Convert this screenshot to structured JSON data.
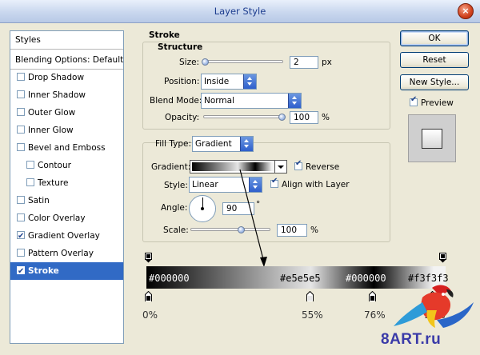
{
  "window": {
    "title": "Layer Style",
    "close_icon": "×"
  },
  "styles_panel": {
    "header": "Styles",
    "blending": "Blending Options: Default",
    "items": [
      {
        "label": "Drop Shadow",
        "checked": false
      },
      {
        "label": "Inner Shadow",
        "checked": false
      },
      {
        "label": "Outer Glow",
        "checked": false
      },
      {
        "label": "Inner Glow",
        "checked": false
      },
      {
        "label": "Bevel and Emboss",
        "checked": false
      },
      {
        "label": "Contour",
        "checked": false
      },
      {
        "label": "Texture",
        "checked": false
      },
      {
        "label": "Satin",
        "checked": false
      },
      {
        "label": "Color Overlay",
        "checked": false
      },
      {
        "label": "Gradient Overlay",
        "checked": true
      },
      {
        "label": "Pattern Overlay",
        "checked": false
      },
      {
        "label": "Stroke",
        "checked": true,
        "selected": true
      }
    ]
  },
  "stroke": {
    "title": "Stroke",
    "structure_title": "Structure",
    "size_label": "Size:",
    "size_value": "2",
    "size_unit": "px",
    "position_label": "Position:",
    "position_value": "Inside",
    "blend_label": "Blend Mode:",
    "blend_value": "Normal",
    "opacity_label": "Opacity:",
    "opacity_value": "100",
    "opacity_unit": "%",
    "filltype_label": "Fill Type:",
    "filltype_value": "Gradient",
    "gradient_label": "Gradient:",
    "reverse_label": "Reverse",
    "reverse_checked": true,
    "style_label": "Style:",
    "style_value": "Linear",
    "align_label": "Align with Layer",
    "align_checked": true,
    "angle_label": "Angle:",
    "angle_value": "90",
    "angle_unit": "°",
    "scale_label": "Scale:",
    "scale_value": "100",
    "scale_unit": "%"
  },
  "buttons": {
    "ok": "OK",
    "reset": "Reset",
    "new_style": "New Style...",
    "preview_label": "Preview",
    "preview_checked": true
  },
  "gradient_stops": [
    {
      "color": "#000000",
      "position": "0%"
    },
    {
      "color": "#e5e5e5",
      "position": "55%"
    },
    {
      "color": "#000000",
      "position": "76%"
    },
    {
      "color": "#f3f3f3",
      "position": "96%"
    }
  ],
  "accent_color": "#316ac5",
  "watermark": "8ART.ru"
}
